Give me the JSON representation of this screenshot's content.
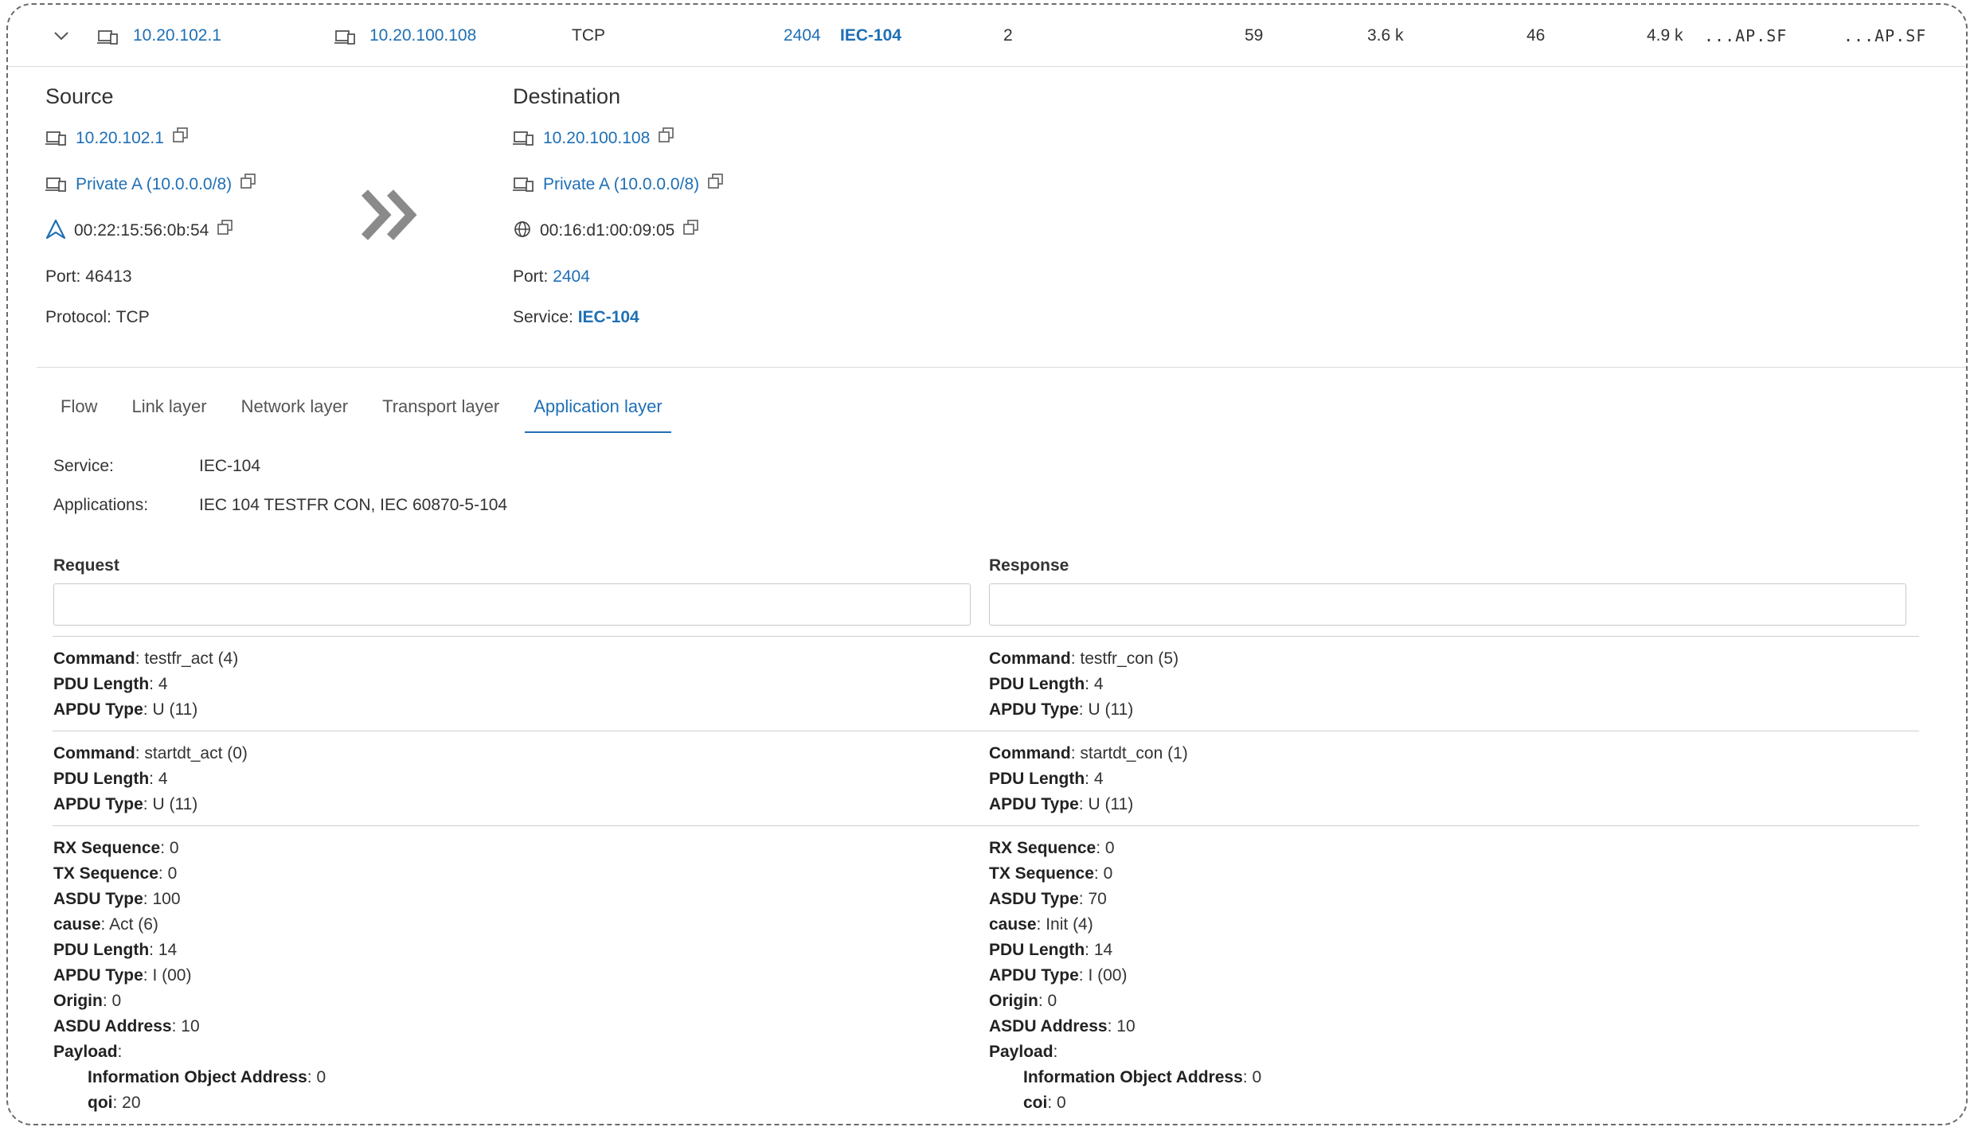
{
  "flow_row": {
    "src_ip": "10.20.102.1",
    "dst_ip": "10.20.100.108",
    "protocol": "TCP",
    "dst_port": "2404",
    "service": "IEC-104",
    "count": "2",
    "packets_a": "59",
    "bytes_a": "3.6 k",
    "packets_b": "46",
    "bytes_b": "4.9 k",
    "flags_a": "...AP.SF",
    "flags_b": "...AP.SF"
  },
  "source": {
    "heading": "Source",
    "ip": "10.20.102.1",
    "network": "Private A (10.0.0.0/8)",
    "mac": "00:22:15:56:0b:54",
    "port_label": "Port:",
    "port": "46413",
    "protocol_label": "Protocol:",
    "protocol": "TCP"
  },
  "destination": {
    "heading": "Destination",
    "ip": "10.20.100.108",
    "network": "Private A (10.0.0.0/8)",
    "mac": "00:16:d1:00:09:05",
    "port_label": "Port:",
    "port": "2404",
    "service_label": "Service:",
    "service": "IEC-104"
  },
  "tabs": [
    {
      "label": "Flow"
    },
    {
      "label": "Link layer"
    },
    {
      "label": "Network layer"
    },
    {
      "label": "Transport layer"
    },
    {
      "label": "Application layer",
      "active": true
    }
  ],
  "app": {
    "service_label": "Service:",
    "service": "IEC-104",
    "applications_label": "Applications:",
    "applications": "IEC 104 TESTFR CON, IEC 60870-5-104",
    "request_label": "Request",
    "response_label": "Response",
    "request_filter": "",
    "response_filter": ""
  },
  "pdus": [
    {
      "request": [
        {
          "k": "Command",
          "v": "testfr_act (4)"
        },
        {
          "k": "PDU Length",
          "v": "4"
        },
        {
          "k": "APDU Type",
          "v": "U (11)"
        }
      ],
      "response": [
        {
          "k": "Command",
          "v": "testfr_con (5)"
        },
        {
          "k": "PDU Length",
          "v": "4"
        },
        {
          "k": "APDU Type",
          "v": "U (11)"
        }
      ]
    },
    {
      "request": [
        {
          "k": "Command",
          "v": "startdt_act (0)"
        },
        {
          "k": "PDU Length",
          "v": "4"
        },
        {
          "k": "APDU Type",
          "v": "U (11)"
        }
      ],
      "response": [
        {
          "k": "Command",
          "v": "startdt_con (1)"
        },
        {
          "k": "PDU Length",
          "v": "4"
        },
        {
          "k": "APDU Type",
          "v": "U (11)"
        }
      ]
    },
    {
      "request": [
        {
          "k": "RX Sequence",
          "v": "0"
        },
        {
          "k": "TX Sequence",
          "v": "0"
        },
        {
          "k": "ASDU Type",
          "v": "100"
        },
        {
          "k": "cause",
          "v": "Act (6)"
        },
        {
          "k": "PDU Length",
          "v": "14"
        },
        {
          "k": "APDU Type",
          "v": "I (00)"
        },
        {
          "k": "Origin",
          "v": "0"
        },
        {
          "k": "ASDU Address",
          "v": "10"
        },
        {
          "k": "Payload",
          "v": ""
        },
        {
          "k": "Information Object Address",
          "v": "0",
          "indent": true
        },
        {
          "k": "qoi",
          "v": "20",
          "indent": true
        }
      ],
      "response": [
        {
          "k": "RX Sequence",
          "v": "0"
        },
        {
          "k": "TX Sequence",
          "v": "0"
        },
        {
          "k": "ASDU Type",
          "v": "70"
        },
        {
          "k": "cause",
          "v": "Init (4)"
        },
        {
          "k": "PDU Length",
          "v": "14"
        },
        {
          "k": "APDU Type",
          "v": "I (00)"
        },
        {
          "k": "Origin",
          "v": "0"
        },
        {
          "k": "ASDU Address",
          "v": "10"
        },
        {
          "k": "Payload",
          "v": ""
        },
        {
          "k": "Information Object Address",
          "v": "0",
          "indent": true
        },
        {
          "k": "coi",
          "v": "0",
          "indent": true
        }
      ]
    }
  ]
}
